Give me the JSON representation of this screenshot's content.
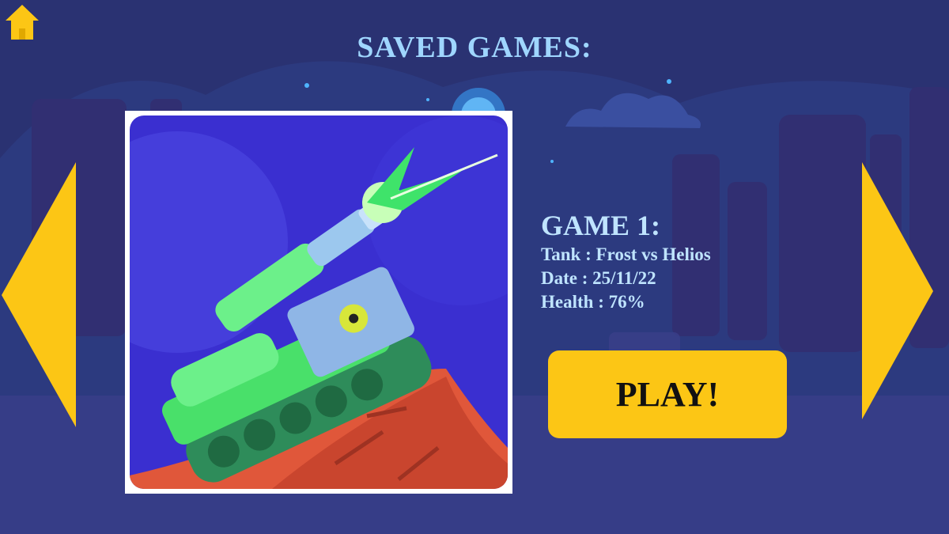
{
  "header": {
    "title": "SAVED GAMES:"
  },
  "nav": {
    "home_icon": "home-icon",
    "prev_icon": "arrow-left-icon",
    "next_icon": "arrow-right-icon"
  },
  "game": {
    "name": "GAME 1:",
    "tank_line": "Tank : Frost vs Helios",
    "date_line": "Date : 25/11/22",
    "health_line": "Health : 76%"
  },
  "actions": {
    "play_label": "PLAY!"
  },
  "colors": {
    "background": "#2a3272",
    "accent_yellow": "#fcc615",
    "title_blue": "#9fd6ff",
    "info_text": "#bfe4ff"
  }
}
